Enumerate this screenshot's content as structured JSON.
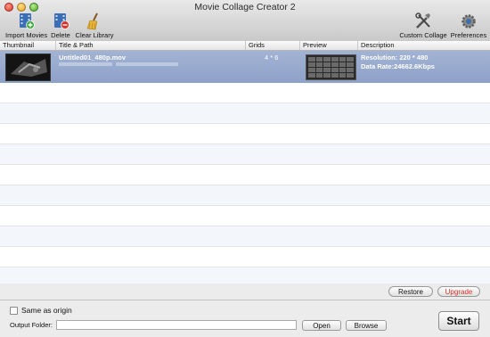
{
  "window": {
    "title": "Movie Collage Creator 2"
  },
  "toolbar": {
    "import_movies": "Import Movies",
    "delete": "Delete",
    "clear_library": "Clear Library",
    "custom_collage": "Custom Collage",
    "preferences": "Preferences"
  },
  "table": {
    "columns": [
      "Thumbnail",
      "Title & Path",
      "Grids",
      "Preview",
      "Description"
    ],
    "rows": [
      {
        "title": "Untitled01_480p.mov",
        "grids": "4 * 6",
        "resolution": "Resolution: 220 * 480",
        "data_rate": "Data Rate:24662.6Kbps"
      }
    ]
  },
  "buttons": {
    "restore": "Restore",
    "upgrade": "Upgrade",
    "open": "Open",
    "browse": "Browse",
    "start": "Start"
  },
  "options": {
    "same_as_origin": "Same as origin",
    "output_folder_label": "Output Folder:",
    "output_folder_value": ""
  },
  "colors": {
    "selection": "#98aacd",
    "upgrade_text": "#d6322b"
  }
}
